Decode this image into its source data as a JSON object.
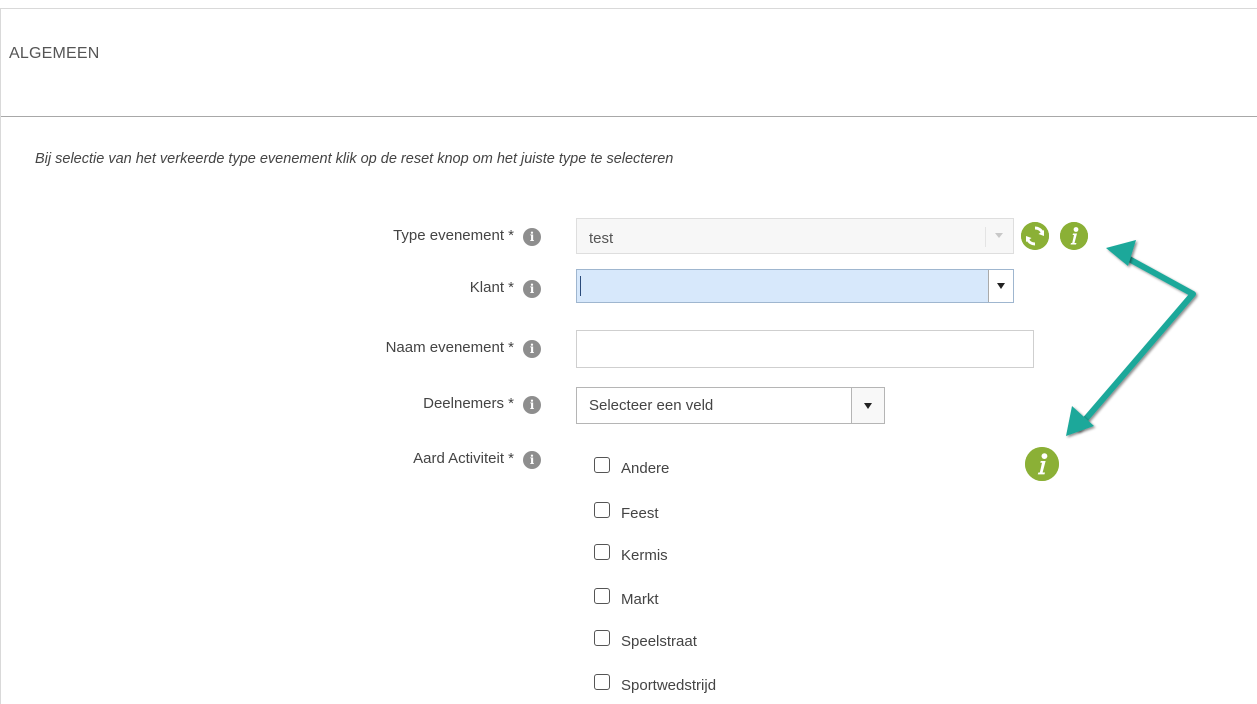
{
  "section": {
    "title": "ALGEMEEN"
  },
  "hint": "Bij selectie van het verkeerde type evenement klik op de reset knop om het juiste type te selecteren",
  "fields": {
    "type": {
      "label": "Type evenement *",
      "value": "test"
    },
    "klant": {
      "label": "Klant *",
      "value": ""
    },
    "naam": {
      "label": "Naam evenement *",
      "value": ""
    },
    "deelnemers": {
      "label": "Deelnemers *",
      "value": "Selecteer een veld"
    },
    "aard": {
      "label": "Aard Activiteit *"
    }
  },
  "aard_options": [
    "Andere",
    "Feest",
    "Kermis",
    "Markt",
    "Speelstraat",
    "Sportwedstrijd"
  ],
  "icons": {
    "info_small": "info-icon",
    "refresh": "refresh-icon",
    "info_large": "info-icon"
  },
  "colors": {
    "accent_green": "#8bb036",
    "annotation_arrow": "#1aa89a"
  }
}
